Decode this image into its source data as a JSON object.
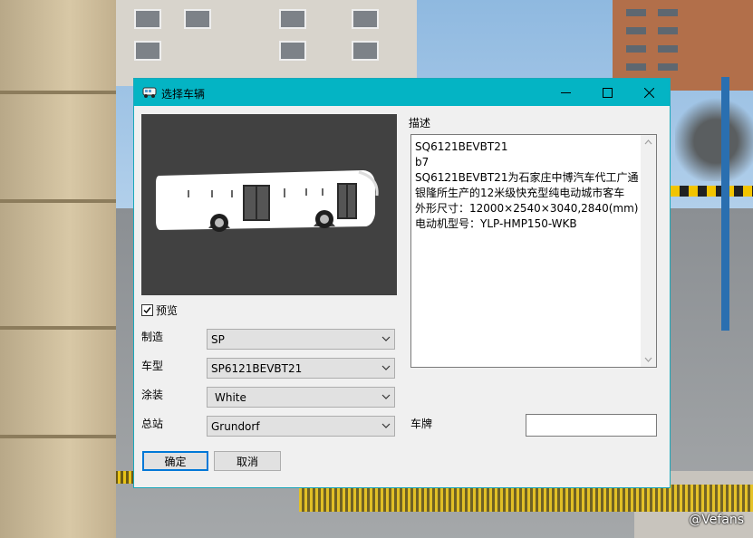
{
  "window": {
    "title": "选择车辆"
  },
  "preview": {
    "checkbox_label": "预览",
    "checked": true
  },
  "fields": {
    "make_label": "制造",
    "make_value": "SP",
    "model_label": "车型",
    "model_value": "SP6121BEVBT21",
    "livery_label": "涂装",
    "livery_value": "White",
    "depot_label": "总站",
    "depot_value": "Grundorf"
  },
  "buttons": {
    "ok": "确定",
    "cancel": "取消"
  },
  "description": {
    "label": "描述",
    "lines": [
      "SQ6121BEVBT21",
      "b7",
      "SQ6121BEVBT21为石家庄中博汽车代工广通",
      "银隆所生产的12米级快充型纯电动城市客车",
      "外形尺寸：12000×2540×3040,2840(mm)",
      "电动机型号：YLP-HMP150-WKB"
    ]
  },
  "plate": {
    "label": "车牌",
    "value": ""
  },
  "watermark": "@Vefans",
  "colors": {
    "titlebar": "#04b4c4",
    "accent": "#0078d7"
  }
}
